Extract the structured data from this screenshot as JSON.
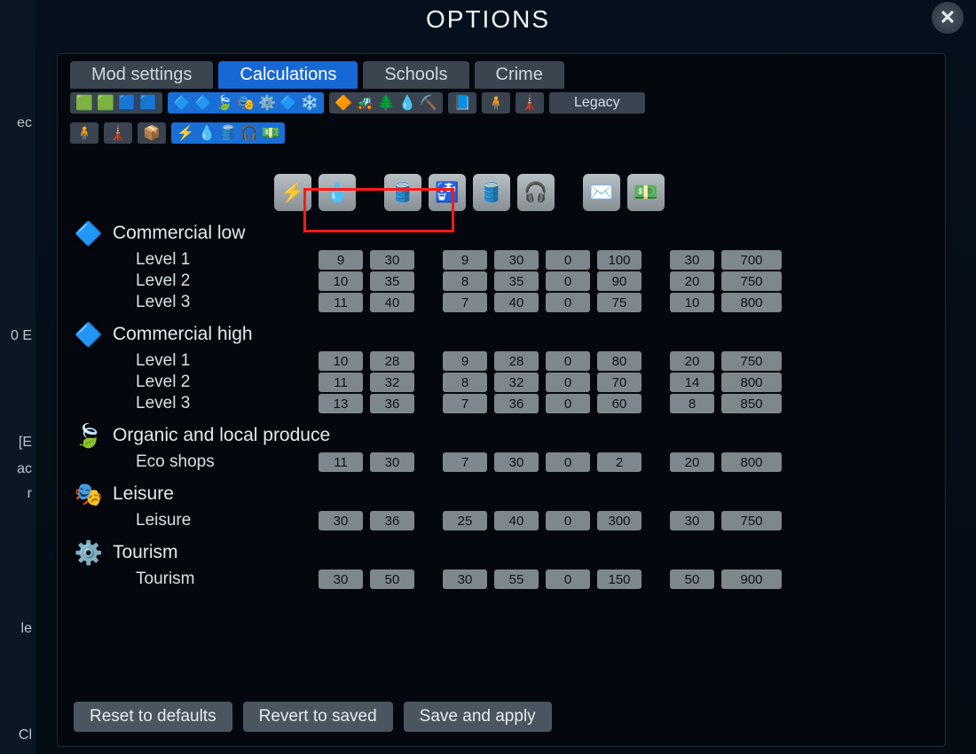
{
  "title": "OPTIONS",
  "tabs": [
    "Mod settings",
    "Calculations",
    "Schools",
    "Crime"
  ],
  "active_tab": 1,
  "legacy_label": "Legacy",
  "bottom_buttons": [
    "Reset to defaults",
    "Revert to saved",
    "Save and apply"
  ],
  "left_fragments": [
    "ec",
    "0 E",
    "[E",
    "ac",
    "r",
    "le",
    "Cl"
  ],
  "header_icons": [
    "electricity",
    "water",
    "sewage",
    "garbage",
    "pollution",
    "noise",
    "mail",
    "income"
  ],
  "toolbar_row1": [
    {
      "id": "res-green",
      "icons": [
        "🟩",
        "🟩",
        "🟦",
        "🟦"
      ],
      "sel": false
    },
    {
      "id": "com-blue",
      "icons": [
        "🔷",
        "🔷",
        "🍃",
        "🎭",
        "⚙️",
        "🔷",
        "❄️"
      ],
      "sel": true
    },
    {
      "id": "ind",
      "icons": [
        "🔶",
        "🚜",
        "🌲",
        "💧",
        "⛏️"
      ],
      "sel": false
    },
    {
      "id": "office",
      "icons": [
        "📘"
      ],
      "sel": false
    },
    {
      "id": "unique",
      "icons": [
        "🧍"
      ],
      "sel": false
    },
    {
      "id": "monument",
      "icons": [
        "🗼"
      ],
      "sel": false
    }
  ],
  "toolbar_row2": [
    {
      "id": "r2a",
      "icons": [
        "🧍"
      ],
      "sel": false
    },
    {
      "id": "r2b",
      "icons": [
        "🗼"
      ],
      "sel": false
    },
    {
      "id": "r2c",
      "icons": [
        "📦"
      ],
      "sel": false
    },
    {
      "id": "r2d",
      "icons": [
        "⚡",
        "💧",
        "🛢️",
        "🎧",
        "💵"
      ],
      "sel": true
    }
  ],
  "categories": [
    {
      "name": "Commercial low",
      "icon": "🔷",
      "color": "#2aa8ff",
      "levels": [
        {
          "label": "Level 1",
          "v": [
            9,
            30,
            9,
            30,
            0,
            100,
            30,
            700
          ]
        },
        {
          "label": "Level 2",
          "v": [
            10,
            35,
            8,
            35,
            0,
            90,
            20,
            750
          ]
        },
        {
          "label": "Level 3",
          "v": [
            11,
            40,
            7,
            40,
            0,
            75,
            10,
            800
          ]
        }
      ]
    },
    {
      "name": "Commercial high",
      "icon": "🔷",
      "color": "#1a8ae6",
      "levels": [
        {
          "label": "Level 1",
          "v": [
            10,
            28,
            9,
            28,
            0,
            80,
            20,
            750
          ]
        },
        {
          "label": "Level 2",
          "v": [
            11,
            32,
            8,
            32,
            0,
            70,
            14,
            800
          ]
        },
        {
          "label": "Level 3",
          "v": [
            13,
            36,
            7,
            36,
            0,
            60,
            8,
            850
          ]
        }
      ]
    },
    {
      "name": "Organic and local produce",
      "icon": "🍃",
      "color": "#66cc33",
      "levels": [
        {
          "label": "Eco shops",
          "v": [
            11,
            30,
            7,
            30,
            0,
            2,
            20,
            800
          ]
        }
      ]
    },
    {
      "name": "Leisure",
      "icon": "🎭",
      "color": "#e6e6e6",
      "levels": [
        {
          "label": "Leisure",
          "v": [
            30,
            36,
            25,
            40,
            0,
            300,
            30,
            750
          ]
        }
      ]
    },
    {
      "name": "Tourism",
      "icon": "⚙️",
      "color": "#e6c766",
      "levels": [
        {
          "label": "Tourism",
          "v": [
            30,
            50,
            30,
            55,
            0,
            150,
            50,
            900
          ]
        }
      ]
    }
  ]
}
